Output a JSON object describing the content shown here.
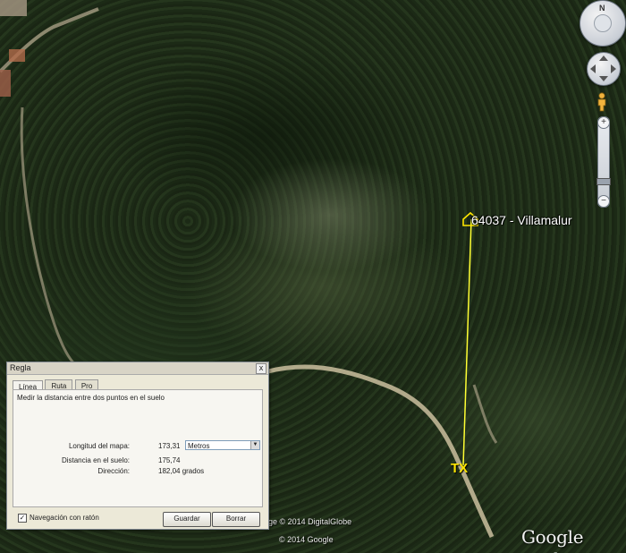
{
  "map": {
    "placemark_label": "64037 - Villamalur",
    "tx_label": "TX",
    "copyright_imagery": "ge © 2014 DigitalGlobe",
    "copyright_google": "© 2014 Google",
    "logo": {
      "word1": "Google",
      "word2": "earth"
    },
    "path_color": "#ffff33"
  },
  "navigation": {
    "north_label": "N",
    "zoom_in": "+",
    "zoom_out": "−",
    "icons": [
      "compass-ring-icon",
      "look-joystick-icon",
      "pegman-icon",
      "zoom-slider"
    ]
  },
  "ruler": {
    "title": "Regla",
    "close": "x",
    "tabs": [
      "Línea",
      "Ruta",
      "Pro"
    ],
    "active_tab": 0,
    "description": "Medir la distancia entre dos puntos en el suelo",
    "map_length_label": "Longitud del mapa:",
    "map_length_value": "173,31",
    "unit_selected": "Metros",
    "ground_distance_label": "Distancia en el suelo:",
    "ground_distance_value": "175,74",
    "heading_label": "Dirección:",
    "heading_value": "182,04 grados",
    "mouse_nav_label": "Navegación con ratón",
    "mouse_nav_checked": true,
    "save_label": "Guardar",
    "clear_label": "Borrar"
  }
}
